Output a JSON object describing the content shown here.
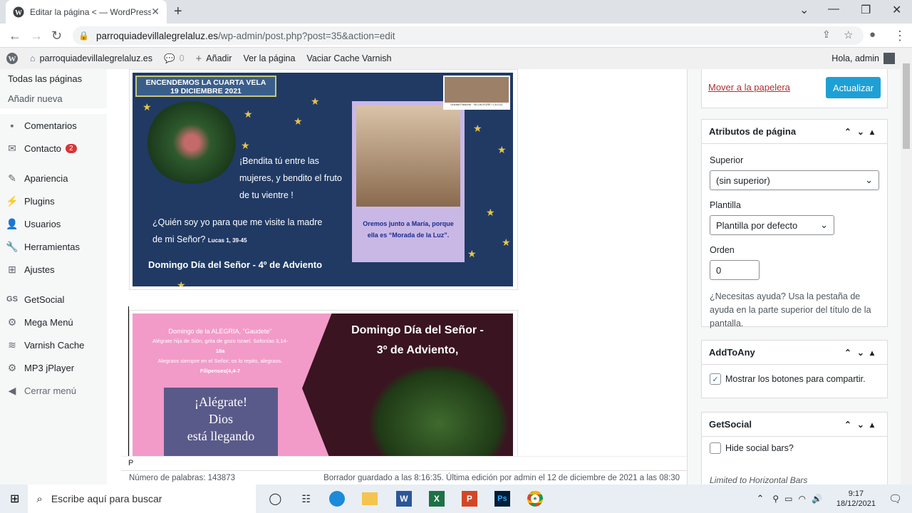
{
  "browser": {
    "tab_title": "Editar la página < — WordPress",
    "url_host": "parroquiadevillalegrelaluz.es",
    "url_path": "/wp-admin/post.php?post=35&action=edit"
  },
  "adminbar": {
    "site": "parroquiadevillalegrelaluz.es",
    "comments_count": "0",
    "add": "Añadir",
    "view": "Ver la página",
    "cache": "Vaciar Cache Varnish",
    "greeting": "Hola, admin"
  },
  "menu": {
    "sub_active": "Todas las páginas",
    "sub_add": "Añadir nueva",
    "items": [
      {
        "label": "Comentarios",
        "icon": "comment-icon"
      },
      {
        "label": "Contacto",
        "icon": "mail-icon",
        "badge": "2"
      },
      {
        "label": "Apariencia",
        "icon": "brush-icon"
      },
      {
        "label": "Plugins",
        "icon": "plugin-icon"
      },
      {
        "label": "Usuarios",
        "icon": "users-icon"
      },
      {
        "label": "Herramientas",
        "icon": "wrench-icon"
      },
      {
        "label": "Ajustes",
        "icon": "settings-icon"
      },
      {
        "label": "GetSocial",
        "icon": "gs-icon"
      },
      {
        "label": "Mega Menú",
        "icon": "gear-icon"
      },
      {
        "label": "Varnish Cache",
        "icon": "varnish-icon"
      },
      {
        "label": "MP3 jPlayer",
        "icon": "gear-icon"
      },
      {
        "label": "Cerrar menú",
        "icon": "collapse-icon"
      }
    ]
  },
  "image1": {
    "banner": "ENCENDEMOS LA  CUARTA VELA",
    "date": "19 DICIEMBRE 2021",
    "quote1": "¡Bendita tú entre las",
    "quote2": "mujeres, y bendito el fruto",
    "quote3": "de tu vientre !",
    "quote4": "¿Quién soy yo para que me visite la madre",
    "quote5": "de mi Señor?",
    "ref": "Lucas 1, 39-45",
    "pray1": "Oremos  junto a María, porque",
    "pray2": "ella es “Morada de la Luz”.",
    "footer": "Domingo Día del Señor - 4º de Adviento",
    "small_caption": "Unidad Pastoral · VILLALEGRE / LA LUZ"
  },
  "image2": {
    "t1": "Domingo de la ALEGRIA, \"Gaudete\"",
    "t2": "Alégrate hija de Sión, grita de gozo Israel. Sofonías 3,14-",
    "t3": "18a",
    "t4": "Alegraos siempre en el Señor; os lo repito, alegraos.",
    "t5": "Filipenses(4,4-7",
    "t6": "¡Alégrate!",
    "t7": "Dios",
    "t8": "está llegando",
    "head1": "Domingo Día del Señor -",
    "head2": "3º de Adviento,"
  },
  "editor": {
    "path": "P",
    "words": "Número de palabras: 143873",
    "saved": "Borrador guardado a las 8:16:35. Última edición por admin el 12 de diciembre de 2021 a las 08:30"
  },
  "sidebar": {
    "trash": "Mover a la papelera",
    "update": "Actualizar",
    "attr_title": "Atributos de página",
    "parent_label": "Superior",
    "parent_value": "(sin superior)",
    "template_label": "Plantilla",
    "template_value": "Plantilla por defecto",
    "order_label": "Orden",
    "order_value": "0",
    "help": "¿Necesitas ayuda? Usa la pestaña de ayuda en la parte superior del título de la pantalla.",
    "addtoany_title": "AddToAny",
    "addtoany_check": "Mostrar los botones para compartir.",
    "getsocial_title": "GetSocial",
    "getsocial_check": "Hide social bars?",
    "getsocial_note": "Limited to Horizontal Bars"
  },
  "taskbar": {
    "search": "Escribe aquí para buscar",
    "time": "9:17",
    "date": "18/12/2021"
  },
  "colors": {
    "accent": "#2271b1",
    "update_btn": "#1ea0d5",
    "trash": "#b32d2e",
    "badge": "#d63638"
  }
}
